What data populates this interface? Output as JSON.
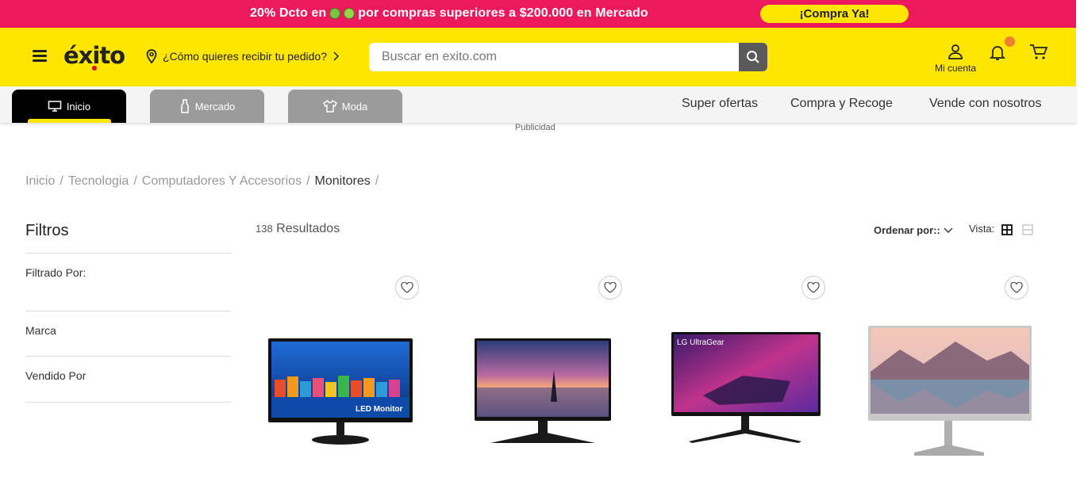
{
  "promo": {
    "text_before": "20% Dcto en",
    "text_after": "por compras superiores a $200.000 en Mercado",
    "cta": "¡Compra Ya!"
  },
  "header": {
    "logo": "éxito",
    "delivery": "¿Cómo quieres recibir tu pedido?",
    "search_placeholder": "Buscar en exito.com",
    "account_label": "Mi cuenta"
  },
  "nav": {
    "tabs": [
      {
        "label": "Inicio",
        "icon": "monitor-icon",
        "active": true
      },
      {
        "label": "Mercado",
        "icon": "bottle-icon",
        "active": false
      },
      {
        "label": "Moda",
        "icon": "shirt-icon",
        "active": false
      }
    ],
    "links": [
      "Super ofertas",
      "Compra y Recoge",
      "Vende con nosotros"
    ]
  },
  "ad_label": "Publicidad",
  "breadcrumb": [
    "Inicio",
    "Tecnologia",
    "Computadores Y Accesorios",
    "Monitores"
  ],
  "filters": {
    "title": "Filtros",
    "items": [
      "Filtrado Por:",
      "Marca",
      "Vendido Por"
    ]
  },
  "results": {
    "count": "138",
    "label": "Resultados"
  },
  "sort": {
    "label": "Ordenar por::",
    "view_label": "Vista:"
  },
  "products": [
    {
      "image": "led-monitor-image",
      "text": "LED Monitor"
    },
    {
      "image": "monitor-sunset-image"
    },
    {
      "image": "lg-ultragear-monitor-image",
      "text": "LG UltraGear"
    },
    {
      "image": "monitor-mountain-image"
    }
  ],
  "colors": {
    "brand_yellow": "#ffe600",
    "promo_pink": "#ec1a5c",
    "nav_bg": "#f4f4f4"
  }
}
